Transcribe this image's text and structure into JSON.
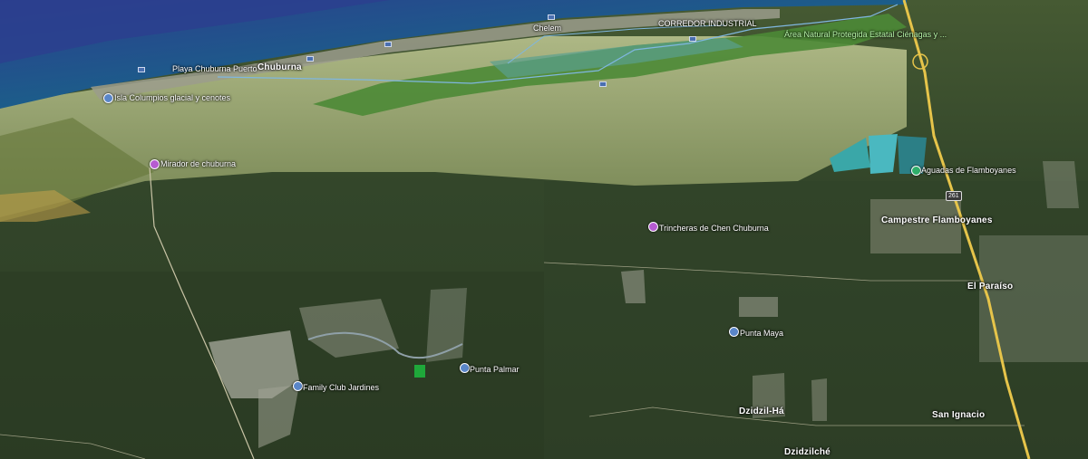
{
  "map": {
    "colors": {
      "sea": "#1f4b86",
      "coast": "#1f8c7a",
      "lagoon": "#4f8a3a",
      "wetland": "#a9b683",
      "forest": "#34472a",
      "highway": "#e6c44a",
      "route": "#7fb7e0"
    },
    "labels": {
      "chuburna": "Chuburna",
      "playa_chuburna": "Playa Chuburna Puerto",
      "chelem": "Chelem",
      "corredor": "CORREDOR INDUSTRIAL",
      "area_protegida": "Área Natural Protegida Estatal Ciénagas y ...",
      "campestre": "Campestre Flamboyanes",
      "el_paraiso": "El Paraíso",
      "dzidzil_ha": "Dzidzil-Há",
      "dzidzilche": "Dzidzilché",
      "san_ignacio": "San Ignacio",
      "highway_shield": "261"
    },
    "places": [
      {
        "id": "isla-columpios",
        "label": "Isla Columpios glacial y cenotes",
        "color": "blue"
      },
      {
        "id": "mirador",
        "label": "Mirador de chuburna",
        "color": "purple"
      },
      {
        "id": "aguadas",
        "label": "Aguadas de Flamboyanes",
        "color": "green"
      },
      {
        "id": "trincheras",
        "label": "Trincheras de Chen Chuburna",
        "color": "purple"
      },
      {
        "id": "punta-maya",
        "label": "Punta Maya",
        "color": "blue"
      },
      {
        "id": "punta-palmar",
        "label": "Punta Palmar",
        "color": "blue"
      },
      {
        "id": "family-club",
        "label": "Family Club Jardines",
        "color": "blue"
      }
    ]
  }
}
